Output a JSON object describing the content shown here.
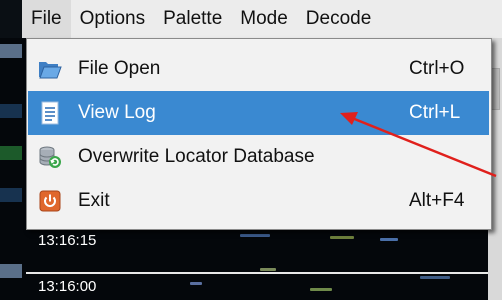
{
  "menubar": {
    "items": [
      "File",
      "Options",
      "Palette",
      "Mode",
      "Decode"
    ]
  },
  "file_menu": {
    "items": [
      {
        "label": "File Open",
        "shortcut": "Ctrl+O",
        "icon": "folder-open-icon"
      },
      {
        "label": "View Log",
        "shortcut": "Ctrl+L",
        "icon": "document-icon",
        "selected": true
      },
      {
        "label": "Overwrite Locator Database",
        "shortcut": "",
        "icon": "database-icon"
      },
      {
        "label": "Exit",
        "shortcut": "Alt+F4",
        "icon": "power-icon"
      }
    ]
  },
  "waterfall": {
    "time_labels": [
      "13:16:15",
      "13:16:00"
    ]
  },
  "colors": {
    "selection": "#3a89d1",
    "annotation_arrow": "#e0201c"
  }
}
